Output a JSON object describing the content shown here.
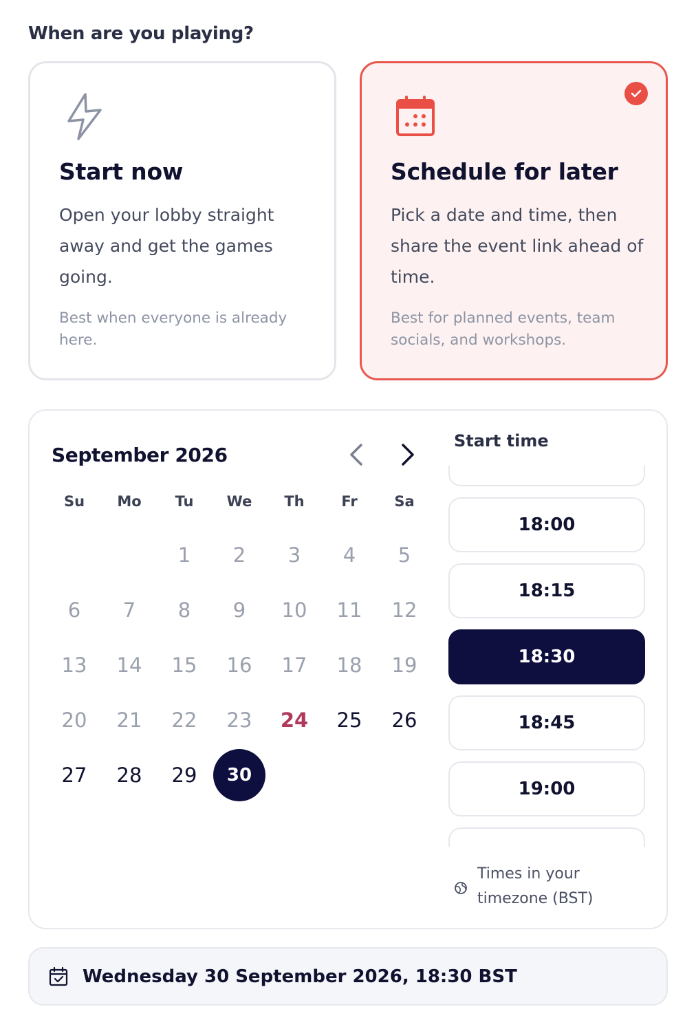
{
  "heading": "When are you playing?",
  "options": {
    "now": {
      "title": "Start now",
      "description": "Open your lobby straight away and get the games going.",
      "hint": "Best when everyone is already here.",
      "icon": "lightning-icon",
      "selected": false
    },
    "later": {
      "title": "Schedule for later",
      "description": "Pick a date and time, then share the event link ahead of time.",
      "hint": "Best for planned events, team socials, and workshops.",
      "icon": "calendar-icon",
      "selected": true
    }
  },
  "calendar": {
    "month_label": "September 2026",
    "weekdays": [
      "Su",
      "Mo",
      "Tu",
      "We",
      "Th",
      "Fr",
      "Sa"
    ],
    "leading_blanks": 2,
    "days": [
      "1",
      "2",
      "3",
      "4",
      "5",
      "6",
      "7",
      "8",
      "9",
      "10",
      "11",
      "12",
      "13",
      "14",
      "15",
      "16",
      "17",
      "18",
      "19",
      "20",
      "21",
      "22",
      "23",
      "24",
      "25",
      "26",
      "27",
      "28",
      "29",
      "30"
    ],
    "today": "24",
    "selected": "30",
    "first_available": 24
  },
  "time_picker": {
    "title": "Start time",
    "slots": [
      "18:00",
      "18:15",
      "18:30",
      "18:45",
      "19:00"
    ],
    "selected": "18:30",
    "timezone_note": "Times in your timezone (BST)"
  },
  "summary": {
    "text": "Wednesday 30 September 2026, 18:30 BST"
  },
  "colors": {
    "accent": "#ea4f45",
    "selected_bg": "#0e0e3f",
    "today": "#b03a5b"
  }
}
